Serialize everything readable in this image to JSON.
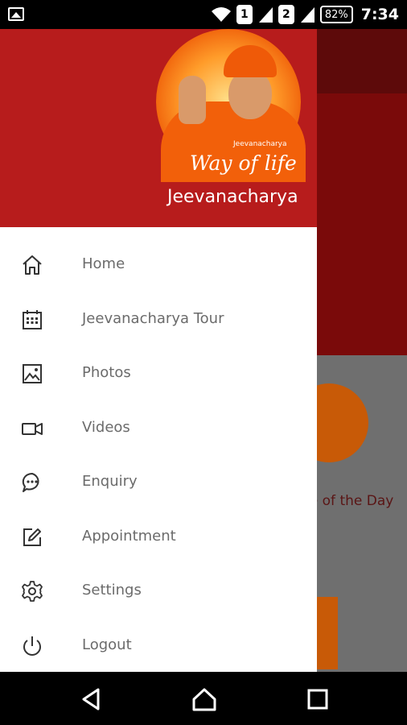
{
  "status_bar": {
    "sim1": "1",
    "sim2": "2",
    "battery": "82%",
    "time": "7:34"
  },
  "drawer": {
    "logo_small": "Jeevanacharya",
    "logo_text": "Way of life",
    "app_name": "Jeevanacharya",
    "items": [
      {
        "label": "Home",
        "icon": "home-icon"
      },
      {
        "label": "Jeevanacharya Tour",
        "icon": "calendar-icon"
      },
      {
        "label": "Photos",
        "icon": "image-icon"
      },
      {
        "label": "Videos",
        "icon": "video-camera-icon"
      },
      {
        "label": "Enquiry",
        "icon": "chat-bubble-icon"
      },
      {
        "label": "Appointment",
        "icon": "edit-icon"
      },
      {
        "label": "Settings",
        "icon": "gear-icon"
      },
      {
        "label": "Logout",
        "icon": "power-icon"
      }
    ]
  },
  "background_app": {
    "tile_text": "ge of the Day"
  },
  "colors": {
    "header_red": "#b71c1c",
    "accent_orange": "#f26a0f",
    "menu_text": "#6b6b6b"
  }
}
